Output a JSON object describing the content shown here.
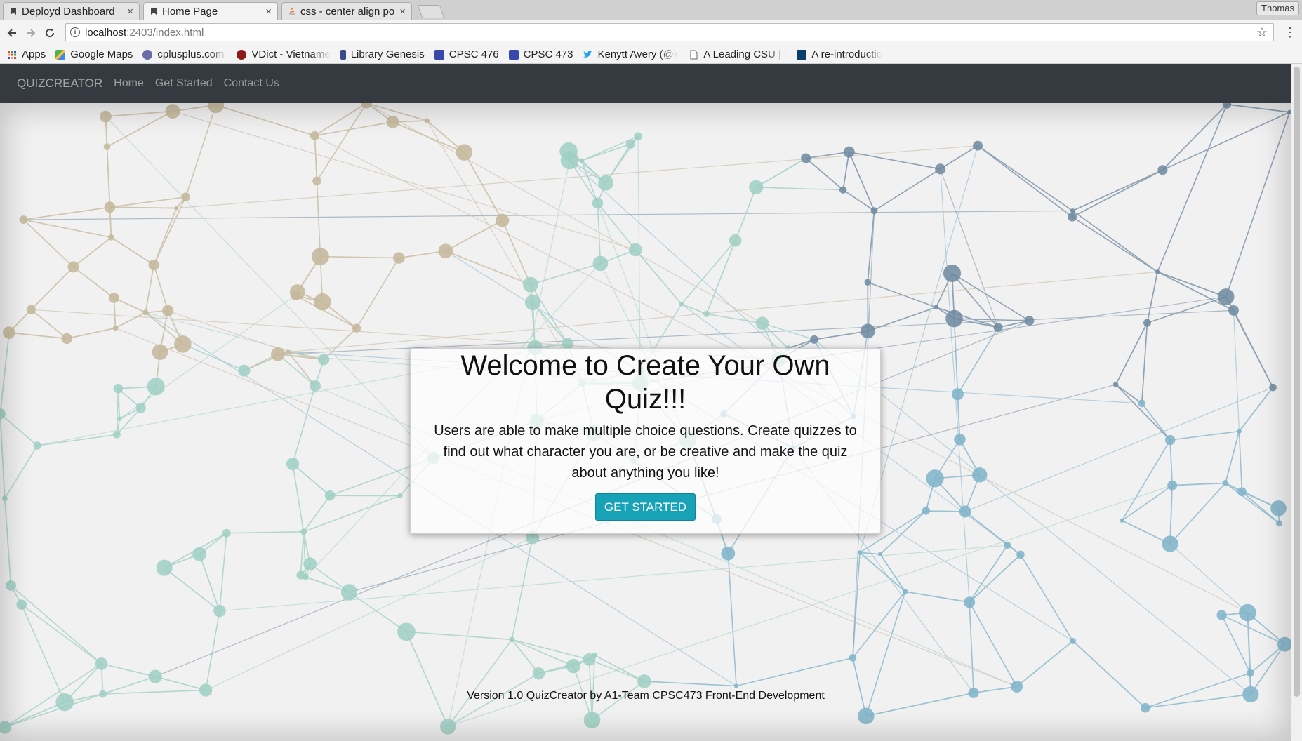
{
  "browser": {
    "tabs": [
      {
        "title": "Deployd Dashboard",
        "active": false
      },
      {
        "title": "Home Page",
        "active": true
      },
      {
        "title": "css - center align po",
        "active": false
      }
    ],
    "close_glyph": "×",
    "profile": "Thomas",
    "url_host": "localhost",
    "url_path": ":2403/index.html",
    "bookmarks": [
      {
        "label": "Apps",
        "icon": "apps-grid-icon"
      },
      {
        "label": "Google Maps",
        "icon": "google-maps-icon"
      },
      {
        "label": "cplusplus.com - T",
        "icon": "cplusplus-icon"
      },
      {
        "label": "VDict - Vietname",
        "icon": "vdict-icon"
      },
      {
        "label": "Library Genesis",
        "icon": "library-genesis-icon"
      },
      {
        "label": "CPSC 476",
        "icon": "calendar-icon"
      },
      {
        "label": "CPSC 473",
        "icon": "calendar-icon"
      },
      {
        "label": "Kenytt Avery (@k",
        "icon": "twitter-icon"
      },
      {
        "label": "A Leading CSU | C",
        "icon": "page-icon"
      },
      {
        "label": "A re-introductio",
        "icon": "mdn-icon"
      }
    ]
  },
  "navbar": {
    "brand": "QUIZCREATOR",
    "links": [
      "Home",
      "Get Started",
      "Contact Us"
    ]
  },
  "hero": {
    "title": "Welcome to Create Your Own Quiz!!!",
    "text": "Users are able to make multiple choice questions. Create quizzes to find out what character you are, or be creative and make the quiz about anything you like!",
    "button": "GET STARTED"
  },
  "footer": {
    "text": "Version 1.0 QuizCreator by A1-Team CPSC473 Front-End Development"
  },
  "colors": {
    "navbar_bg": "#343a40",
    "button_bg": "#17a2b8"
  }
}
